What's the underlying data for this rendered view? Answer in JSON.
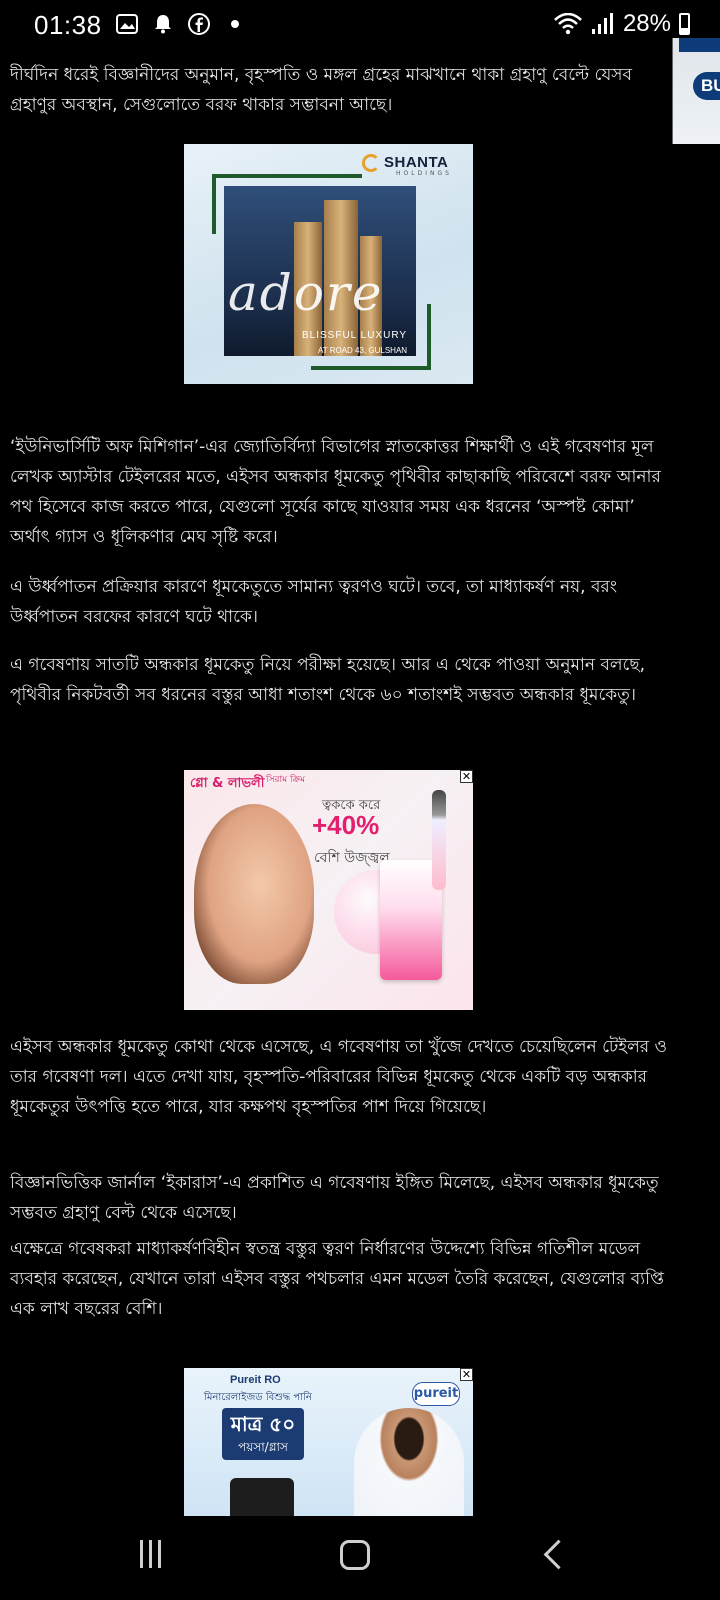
{
  "status_bar": {
    "time": "01:38",
    "battery": "28%",
    "icons_left": [
      "image-icon",
      "notification-bell-icon",
      "facebook-icon",
      "dot-icon"
    ],
    "icons_right": [
      "wifi-icon",
      "signal-icon",
      "battery-icon"
    ]
  },
  "side_ad": {
    "label": "BU"
  },
  "article": {
    "p1": "দীর্ঘদিন ধরেই বিজ্ঞানীদের অনুমান, বৃহস্পতি ও মঙ্গল গ্রহের মাঝখানে থাকা গ্রহাণু বেল্টে যেসব গ্রহাণুর অবস্থান, সেগুলোতে বরফ থাকার সম্ভাবনা আছে।",
    "p2": "‘ইউনিভার্সিটি অফ মিশিগান’-এর জ্যোতির্বিদ্যা বিভাগের স্নাতকোত্তর শিক্ষার্থী ও এই গবেষণার মূল লেখক অ্যাস্টার টেইলরের মতে, এইসব অন্ধকার ধূমকেতু পৃথিবীর কাছাকাছি পরিবেশে বরফ আনার পথ হিসেবে কাজ করতে পারে, যেগুলো সূর্যের কাছে যাওয়ার সময় এক ধরনের ‘অস্পষ্ট কোমা’ অর্থাৎ গ্যাস ও ধূলিকণার মেঘ সৃষ্টি করে।",
    "p3": "এ উর্ধ্বপাতন প্রক্রিয়ার কারণে ধূমকেতুতে সামান্য ত্বরণও ঘটে। তবে, তা মাধ্যাকর্ষণ নয়, বরং উর্ধ্বপাতন বরফের কারণে ঘটে থাকে।",
    "p4": "এ গবেষণায় সাতটি অন্ধকার ধূমকেতু নিয়ে পরীক্ষা হয়েছে। আর এ থেকে পাওয়া অনুমান বলছে, পৃথিবীর নিকটবর্তী সব ধরনের বস্তুর আধা শতাংশ থেকে ৬০ শতাংশই সম্ভবত অন্ধকার ধূমকেতু।",
    "p5": "এইসব অন্ধকার ধূমকেতু কোথা থেকে এসেছে, এ গবেষণায় তা খুঁজে দেখতে চেয়েছিলেন টেইলর ও তার গবেষণা দল। এতে দেখা যায়, বৃহস্পতি-পরিবারের বিভিন্ন ধূমকেতু থেকে একটি বড় অন্ধকার ধূমকেতুর উৎপত্তি হতে পারে, যার কক্ষপথ বৃহস্পতির পাশ দিয়ে গিয়েছে।",
    "p6": "বিজ্ঞানভিত্তিক জার্নাল ‘ইকারাস’-এ প্রকাশিত এ গবেষণায় ইঙ্গিত মিলেছে, এইসব অন্ধকার ধূমকেতু সম্ভবত গ্রহাণু বেল্ট থেকে এসেছে।",
    "p7": "এক্ষেত্রে গবেষকরা মাধ্যাকর্ষণবিহীন স্বতন্ত্র বস্তুর ত্বরণ নির্ধারণের উদ্দেশ্যে বিভিন্ন গতিশীল মডেল ব্যবহার করেছেন, যেখানে তারা এইসব বস্তুর পথচলার এমন মডেল তৈরি করেছেন, যেগুলোর ব্যপ্তি এক লাখ বছরের বেশি।"
  },
  "ad_shanta": {
    "brand": "SHANTA",
    "brand_sub": "HOLDINGS",
    "script_word": "adore",
    "tagline": "BLISSFUL LUXURY",
    "location": "AT ROAD 43, GULSHAN"
  },
  "ad_glow": {
    "brand": "গ্লো & লাভলী",
    "brand_sub": "সিরাম ক্রিম",
    "line1": "ত্বককে করে",
    "percent": "+40%",
    "line2": "বেশি উজ্জ্বল"
  },
  "ad_pureit": {
    "title": "Pureit RO",
    "subtitle": "মিনারেলাইজড বিশুদ্ধ পানি",
    "price_line1": "মাত্র ৫০",
    "price_line2": "পয়সা/গ্লাস",
    "logo": "pureit"
  },
  "nav": {
    "buttons": [
      "recent-apps-button",
      "home-button",
      "back-button"
    ]
  }
}
